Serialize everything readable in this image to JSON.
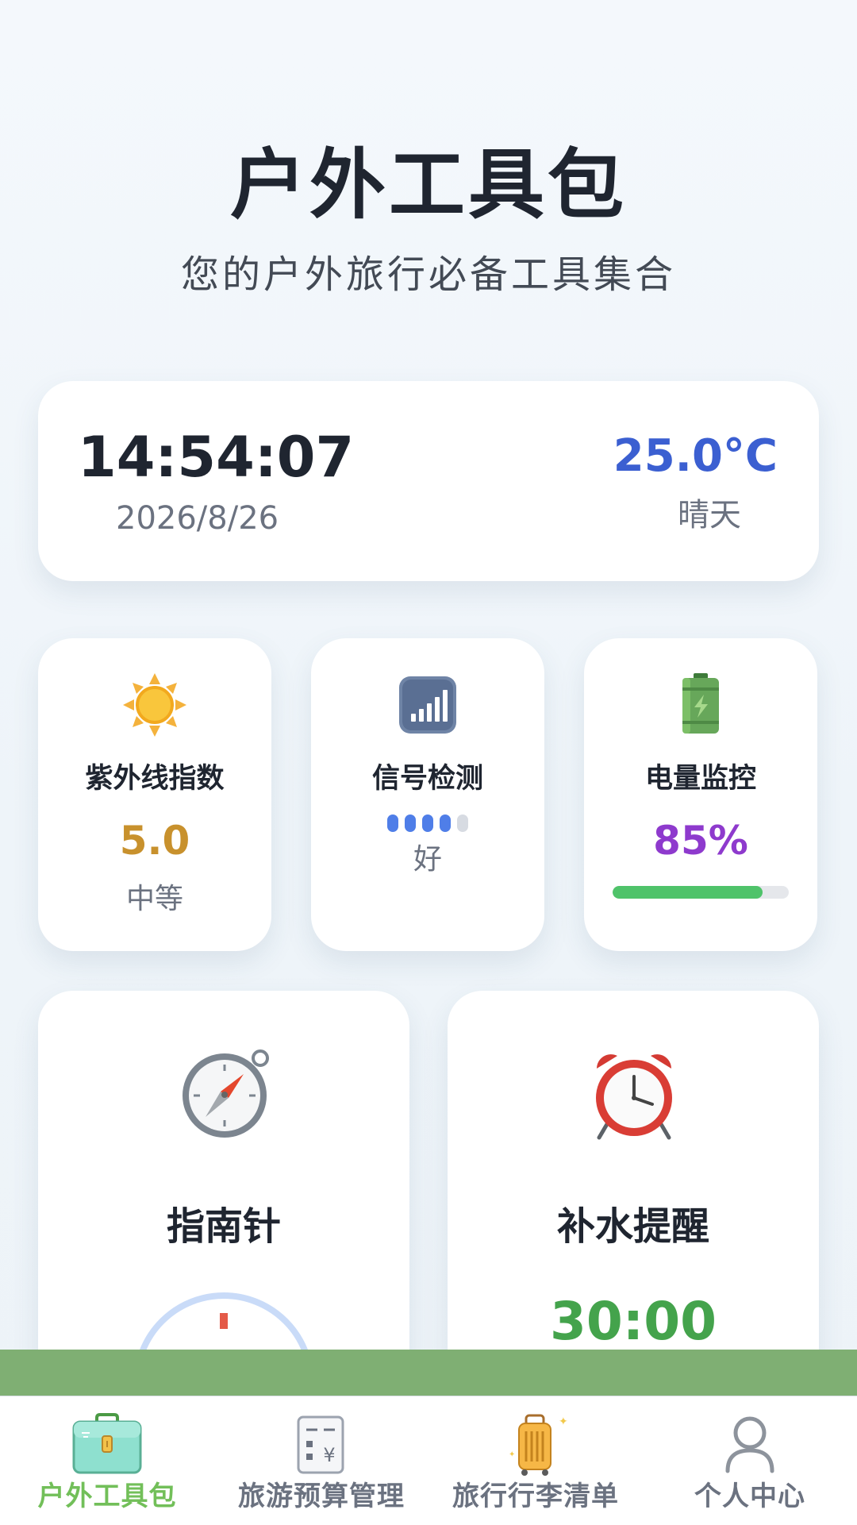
{
  "header": {
    "title": "户外工具包",
    "subtitle": "您的户外旅行必备工具集合"
  },
  "status": {
    "time": "14:54:07",
    "date": "2026/8/26",
    "temperature": "25.0°C",
    "weather": "晴天"
  },
  "tools": {
    "uv": {
      "icon": "sun-icon",
      "label": "紫外线指数",
      "value": "5.0",
      "level": "中等",
      "color": "#C8912D"
    },
    "signal": {
      "icon": "signal-icon",
      "label": "信号检测",
      "strength_bars": 4,
      "total_bars": 5,
      "quality": "好",
      "color": "#4F7EE8"
    },
    "battery": {
      "icon": "battery-icon",
      "label": "电量监控",
      "value": "85%",
      "level_percent": 85,
      "color": "#8E3ACD",
      "bar_color": "#4FC36A"
    },
    "compass": {
      "icon": "compass-icon",
      "label": "指南针"
    },
    "water": {
      "icon": "alarm-clock-icon",
      "label": "补水提醒",
      "countdown": "30:00",
      "color": "#44A34C"
    }
  },
  "tabs": [
    {
      "label": "户外工具包",
      "icon": "toolbox-icon",
      "active": true
    },
    {
      "label": "旅游预算管理",
      "icon": "calculator-icon",
      "active": false
    },
    {
      "label": "旅行行李清单",
      "icon": "luggage-icon",
      "active": false
    },
    {
      "label": "个人中心",
      "icon": "user-icon",
      "active": false
    }
  ],
  "theme": {
    "accent": "#72BF59",
    "strip": "#7FAF73"
  }
}
